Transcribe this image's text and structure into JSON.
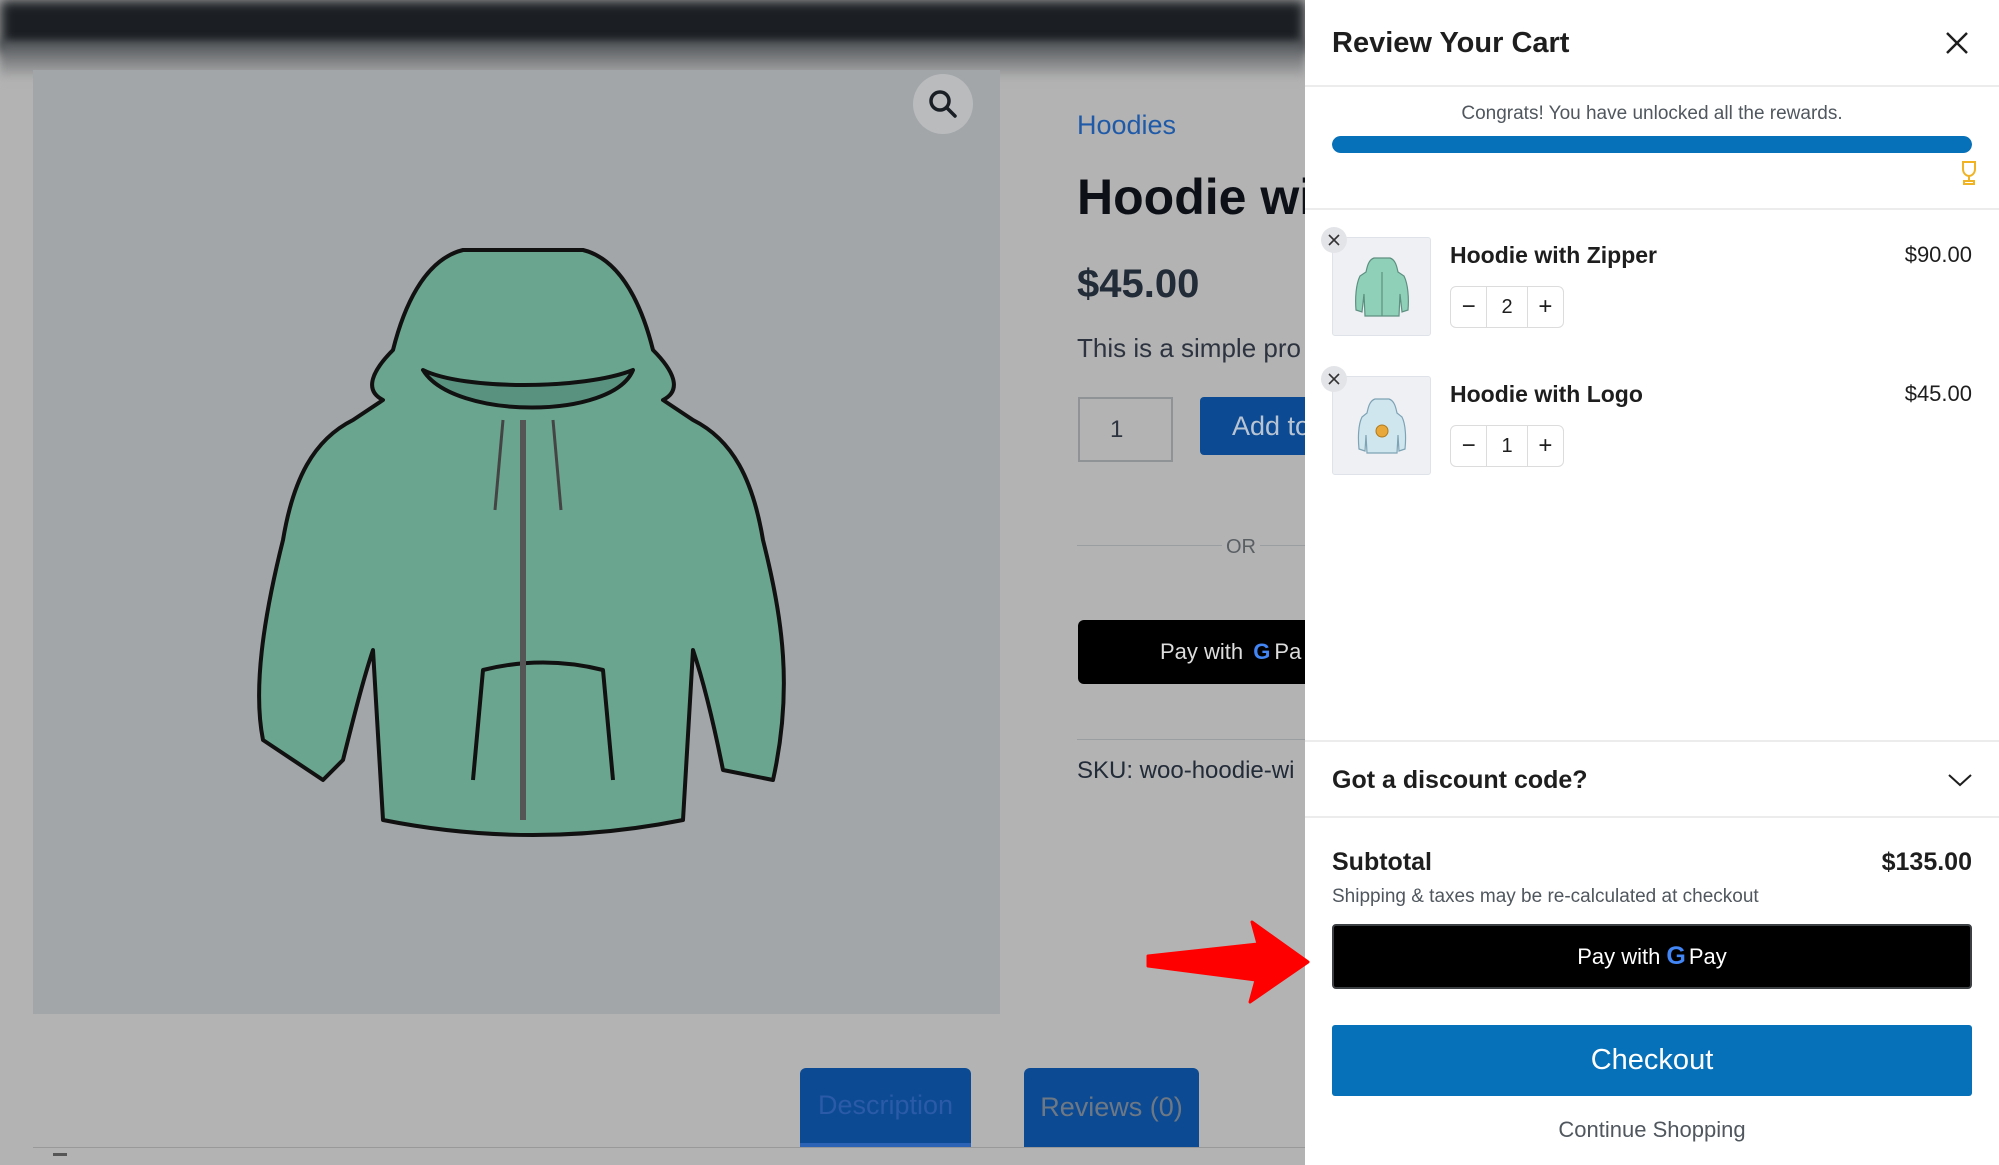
{
  "background_page": {
    "breadcrumb": "Hoodies",
    "product_title": "Hoodie with Zipper",
    "product_title_visible": "Hoodie wi",
    "price": "$45.00",
    "description": "This is a simple product.",
    "description_visible": "This is a simple pro",
    "quantity": "1",
    "add_to_cart_label": "Add to cart",
    "or_label": "OR",
    "gpay_label": "Pay with",
    "gpay_pay": "Pa",
    "sku": "SKU: woo-hoodie-wi",
    "tabs": [
      {
        "label": "Description",
        "active": true
      },
      {
        "label": "Reviews (0)",
        "active": false
      }
    ],
    "icons": {
      "zoom": "search-icon"
    }
  },
  "cart": {
    "title": "Review Your Cart",
    "close_icon": "close-icon",
    "rewards": {
      "message": "Congrats! You have unlocked all the rewards.",
      "progress_percent": 100,
      "icon": "trophy-icon",
      "bar_color": "#0671b8",
      "trophy_color": "#f0b323"
    },
    "items": [
      {
        "name": "Hoodie with Zipper",
        "quantity": "2",
        "price": "$90.00",
        "thumb": "hoodie-zipper-thumbnail"
      },
      {
        "name": "Hoodie with Logo",
        "quantity": "1",
        "price": "$45.00",
        "thumb": "hoodie-logo-thumbnail"
      }
    ],
    "stepper": {
      "minus": "−",
      "plus": "+"
    },
    "discount": {
      "label": "Got a discount code?",
      "icon": "chevron-down-icon"
    },
    "subtotal": {
      "label": "Subtotal",
      "value": "$135.00"
    },
    "shipping_note": "Shipping & taxes may be re-calculated at checkout",
    "gpay": {
      "prefix": "Pay with",
      "g": "G",
      "pay": "Pay"
    },
    "checkout_label": "Checkout",
    "continue_label": "Continue Shopping",
    "accent_color": "#0671b8"
  },
  "annotation": {
    "arrow_color": "#ff0000",
    "arrow_target": "gpay-button"
  }
}
